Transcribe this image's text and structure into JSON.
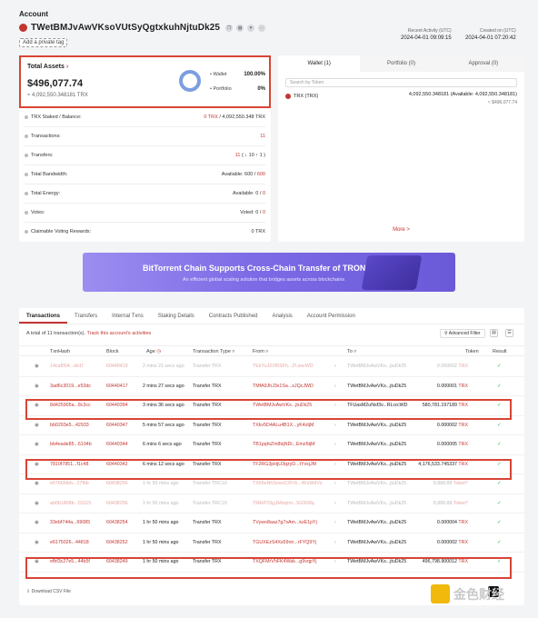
{
  "header": {
    "label": "Account",
    "address": "TWetBMJvAwVKsoVUtSyQgtxkuhNjtuDk25",
    "private_tag_button": "Add a private tag",
    "recent_activity_label": "Recent Activity (UTC)",
    "recent_activity_value": "2024-04-01 09:09:15",
    "created_label": "Created on (UTC)",
    "created_value": "2024-04-01 07:20:42"
  },
  "assets": {
    "label": "Total Assets",
    "value": "$496,077.74",
    "trx": "≈ 4,092,550.348181 TRX",
    "legend": [
      {
        "label": "Wallet",
        "value": "100.00%"
      },
      {
        "label": "Portfolio",
        "value": "0%"
      }
    ]
  },
  "properties": [
    {
      "key": "TRX Staked / Balance:",
      "value_red": "0 TRX",
      "value": " / 4,092,550.348 TRX"
    },
    {
      "key": "Transactions:",
      "value_red": "11",
      "value": ""
    },
    {
      "key": "Transfers:",
      "value_red": "11",
      "value": " ( ↓ 10  ↑ 1 )"
    },
    {
      "key": "Total Bandwidth:",
      "value": "Available: 600 / ",
      "value_red": "600"
    },
    {
      "key": "Total Energy:",
      "value": "Available: 0 / ",
      "value_red": "0"
    },
    {
      "key": "Votes:",
      "value": "Voted: 0 / ",
      "value_red": "0"
    },
    {
      "key": "Claimable Voting Rewards:",
      "value": "0 TRX",
      "value_red": ""
    }
  ],
  "wallet": {
    "tabs": [
      "Wallet (1)",
      "Portfolio (0)",
      "Approval (0)"
    ],
    "search_placeholder": "Search by Token",
    "token_name": "TRX (TRX)",
    "token_amount": "4,092,550.348181 (Available: 4,092,550.348181)",
    "token_usd": "≈ $496,077.74",
    "more": "More >"
  },
  "banner": {
    "title": "BitTorrent Chain Supports Cross-Chain Transfer of TRON Assets",
    "subtitle": "An efficient global scaling solution that bridges assets across blockchains"
  },
  "transactions": {
    "tabs": [
      "Transactions",
      "Transfers",
      "Internal Txns",
      "Staking Details",
      "Contracts Published",
      "Analysis",
      "Account Permission"
    ],
    "summary_prefix": "A total of 11 transaction(s). ",
    "summary_link": "Track this account's activities",
    "advanced_filter": "Advanced Filter",
    "columns": [
      "TxnHash",
      "Block",
      "Age",
      "Transaction Type",
      "From",
      "To",
      "Token",
      "Result"
    ],
    "rows": [
      {
        "hash": "14caf094...eb1f",
        "block": "60440419",
        "age": "2 mins 21 secs ago",
        "type": "Transfer TRX",
        "from": "TEkYuJ2Xf5SFh...Zf.zecWD",
        "to": "TWetBMJvAwVKs...jtuDk25",
        "amount": "0.000002",
        "token": "TRX",
        "faded": true
      },
      {
        "hash": "3ad6c3019...e53dc",
        "block": "60440417",
        "age": "2 mins 27 secs ago",
        "type": "Transfer TRX",
        "from": "TMfA9JhJ3x1Sa...sJQcJWD",
        "to": "TWetBMJvAwVKs...jtuDk25",
        "amount": "0.000001",
        "token": "TRX",
        "faded": false
      },
      {
        "hash": "8d425905a...8c3cc",
        "block": "60440394",
        "age": "3 mins 36 secs ago",
        "type": "Transfer TRX",
        "from": "TWetBMJvAwVKs...jtuDk25",
        "to": "TFUasM2uNsf3v...RLrzcWD",
        "amount": "580,781.197189",
        "token": "TRX",
        "faded": false
      },
      {
        "hash": "bb0293e5...42933",
        "block": "60440347",
        "age": "5 mins 57 secs ago",
        "type": "Transfer TRX",
        "from": "TXkv5D4ALu4B1X...yK4ztjM",
        "to": "TWetBMJvAwVKs...jtuDk25",
        "amount": "0.000002",
        "token": "TRX",
        "faded": false
      },
      {
        "hash": "bb4eade85...6194b",
        "block": "60440344",
        "age": "6 mins 6 secs ago",
        "type": "Transfer TRX",
        "from": "TB1pqhiZm8tqNDi...Emz6tjM",
        "to": "TWetBMJvAwVKs...jtuDk25",
        "amount": "0.000005",
        "token": "TRX",
        "faded": false
      },
      {
        "hash": "7810f7851...f1c48",
        "block": "60440342",
        "age": "6 mins 12 secs ago",
        "type": "Transfer TRX",
        "from": "TF2RG3pHjU3qzyD...tYxxjJM",
        "to": "TWetBMJvAwVKs...jtuDk25",
        "amount": "4,176,533.745337",
        "token": "TRX",
        "faded": false
      },
      {
        "hash": "e676f2bbb...27fbb",
        "block": "60438256",
        "age": "1 hr 50 mins ago",
        "type": "Transfer TRC10",
        "from": "TX66eNhSoxoC2Fr6...4FsWdVs",
        "to": "TWetBMJvAwVKs...jtuDk25",
        "amount": "8,888.88",
        "token": "Token*",
        "faded": true
      },
      {
        "hash": "ab0b1808b...03115",
        "block": "60438256",
        "age": "1 hr 50 mins ago",
        "type": "Transfer TRC10",
        "from": "TMHP29yjJMoqrm...5G5tSfq",
        "to": "TWetBMJvAwVKs...jtuDk25",
        "amount": "8,888.88",
        "token": "Token*",
        "faded": true
      },
      {
        "hash": "33ebf744a...69085",
        "block": "60438254",
        "age": "1 hr 50 mins ago",
        "type": "Transfer TRX",
        "from": "TVywo8aaz7g7sAm...kzE1pYj",
        "to": "TWetBMJvAwVKs...jtuDk25",
        "amount": "0.000004",
        "token": "TRX",
        "faded": false
      },
      {
        "hash": "e6175026...44818",
        "block": "60438252",
        "age": "1 hr 50 mins ago",
        "type": "Transfer TRX",
        "from": "TGUXEzS4Xs59nn...rFYQ9Yj",
        "to": "TWetBMJvAwVKs...jtuDk25",
        "amount": "0.000002",
        "token": "TRX",
        "faded": false
      },
      {
        "hash": "efbf3c27e5...44b5f",
        "block": "60438249",
        "age": "1 hr 50 mins ago",
        "type": "Transfer TRX",
        "from": "TXQFMrVhFK4Wak...g9vqpYj",
        "to": "TWetBMJvAwVKs...jtuDk25",
        "amount": "496,798.900012",
        "token": "TRX",
        "faded": false
      }
    ],
    "download_csv": "Download CSV File"
  },
  "watermark": "金色财经",
  "colors": {
    "accent": "#c23631",
    "highlight_box": "#d94434",
    "success": "#2bb34a",
    "banner": "#7d6be6"
  }
}
